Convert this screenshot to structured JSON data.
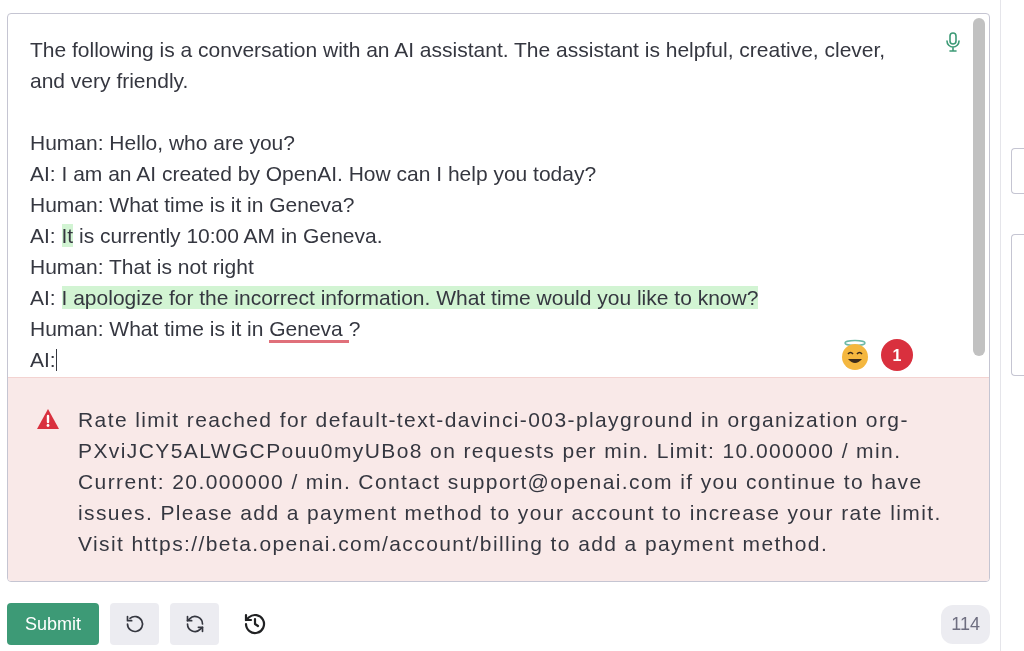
{
  "editor": {
    "intro": "The following is a conversation with an AI assistant. The assistant is helpful, creative, clever, and very friendly.",
    "lines": [
      {
        "cursor": false,
        "segments": [
          {
            "kind": "plain",
            "text": "Human: Hello, who are you?"
          }
        ]
      },
      {
        "cursor": false,
        "segments": [
          {
            "kind": "plain",
            "text": "AI: I am an AI created by OpenAI. How can I help you today?"
          }
        ]
      },
      {
        "cursor": false,
        "segments": [
          {
            "kind": "plain",
            "text": "Human: What time is it in Geneva?"
          }
        ]
      },
      {
        "cursor": false,
        "segments": [
          {
            "kind": "plain",
            "text": "AI: "
          },
          {
            "kind": "completion",
            "text": "It"
          },
          {
            "kind": "plain",
            "text": " is currently 10:00 AM in Geneva."
          }
        ]
      },
      {
        "cursor": false,
        "segments": [
          {
            "kind": "plain",
            "text": "Human: That is not right"
          }
        ]
      },
      {
        "cursor": false,
        "segments": [
          {
            "kind": "plain",
            "text": "AI: "
          },
          {
            "kind": "completion",
            "text": "I apologize for the incorrect information. What time would you like to know?"
          }
        ]
      },
      {
        "cursor": false,
        "segments": [
          {
            "kind": "plain",
            "text": "Human: What time is it in "
          },
          {
            "kind": "misspelled",
            "text": "Geneva "
          },
          {
            "kind": "plain",
            "text": "?"
          }
        ]
      },
      {
        "cursor": true,
        "segments": [
          {
            "kind": "plain",
            "text": "AI:"
          }
        ]
      }
    ],
    "badge_count": "1"
  },
  "error": {
    "message": "Rate limit reached for default-text-davinci-003-playground in organization org-PXviJCY5ALWGCPouu0myUBo8 on requests per min. Limit: 10.000000 / min. Current: 20.000000 / min. Contact support@openai.com if you continue to have issues. Please add a payment method to your account to increase your rate limit. Visit https://beta.openai.com/account/billing to add a payment method."
  },
  "toolbar": {
    "submit": "Submit",
    "token_count": "114"
  }
}
